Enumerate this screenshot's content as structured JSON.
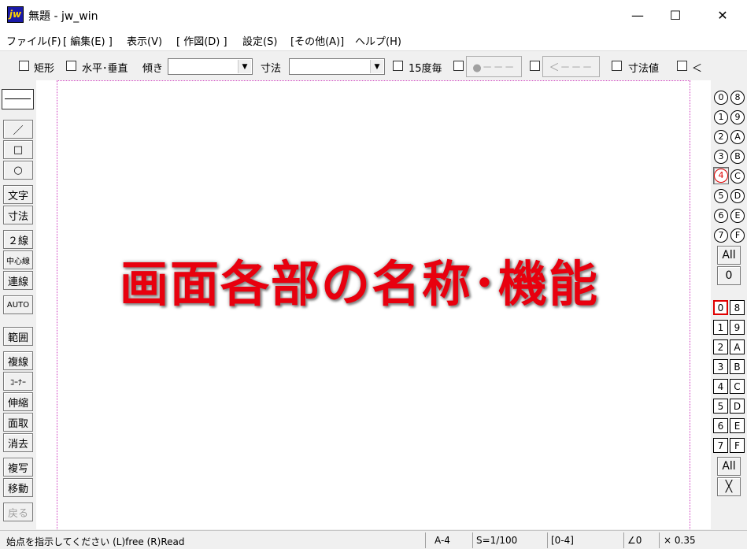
{
  "window": {
    "app_icon_text": "jw",
    "title": "無題 - jw_win",
    "minimize_glyph": "—",
    "maximize_glyph": "☐",
    "close_glyph": "✕"
  },
  "menu": {
    "items": [
      "ファイル(F)",
      "[ 編集(E) ]",
      "表示(V)",
      "[ 作図(D) ]",
      "設定(S)",
      "[その他(A)]",
      "ヘルプ(H)"
    ]
  },
  "toolbar": {
    "rect_label": "矩形",
    "hv_label": "水平･垂直",
    "angle_label": "傾き",
    "angle_value": "",
    "dim_label": "寸法",
    "dim_value": "",
    "deg15_label": "15度毎",
    "circle_btn_label": "●－－－",
    "arrow_btn_label": "＜－－－",
    "dimval_label": "寸法値",
    "lt_label": "＜",
    "dropdown_glyph": "▼"
  },
  "left_tools": {
    "line": "／",
    "rect": "□",
    "circle": "○",
    "text": "文字",
    "dimension": "寸法",
    "double_line": "２線",
    "center_line": "中心線",
    "continuous_line": "連線",
    "auto": "AUTO",
    "range": "範囲",
    "copy_line": "複線",
    "corner": "ｺｰﾅｰ",
    "stretch": "伸縮",
    "chamfer": "面取",
    "erase": "消去",
    "duplicate": "複写",
    "move": "移動",
    "undo": "戻る"
  },
  "overlay": {
    "title": "画面各部の名称･機能",
    "color": "#e8000e"
  },
  "layers": {
    "left_col": [
      "0",
      "1",
      "2",
      "3",
      "4",
      "5",
      "6",
      "7"
    ],
    "right_col": [
      "8",
      "9",
      "A",
      "B",
      "C",
      "D",
      "E",
      "F"
    ],
    "active": "4",
    "all_label": "All",
    "zero_label": "0"
  },
  "groups": {
    "left_col": [
      "0",
      "1",
      "2",
      "3",
      "4",
      "5",
      "6",
      "7"
    ],
    "right_col": [
      "8",
      "9",
      "A",
      "B",
      "C",
      "D",
      "E",
      "F"
    ],
    "active": "0",
    "all_label": "All",
    "x_label": "╳"
  },
  "status": {
    "message": "始点を指示してください (L)free (R)Read",
    "paper": "A-4",
    "scale": "S=1/100",
    "layer": "[0-4]",
    "angle": "∠0",
    "zoom": "× 0.35"
  }
}
